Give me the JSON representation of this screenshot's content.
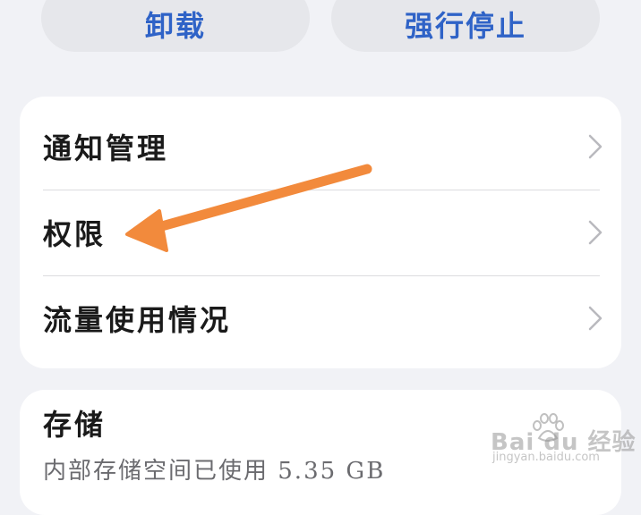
{
  "actions": {
    "uninstall_label": "卸载",
    "force_stop_label": "强行停止"
  },
  "menu": {
    "items": [
      {
        "label": "通知管理"
      },
      {
        "label": "权限"
      },
      {
        "label": "流量使用情况"
      }
    ]
  },
  "storage": {
    "title": "存储",
    "subtitle": "内部存储空间已使用 5.35 GB"
  },
  "watermark": {
    "logo_text": "Bai du 经验",
    "url": "jingyan.baidu.com"
  },
  "colors": {
    "accent": "#2f63c7",
    "background": "#f1f2f6",
    "card": "#ffffff",
    "annotation_arrow": "#f28a3c"
  },
  "icons": {
    "row_chevron": "chevron-right-icon",
    "watermark_logo": "baidu-paw-icon"
  }
}
